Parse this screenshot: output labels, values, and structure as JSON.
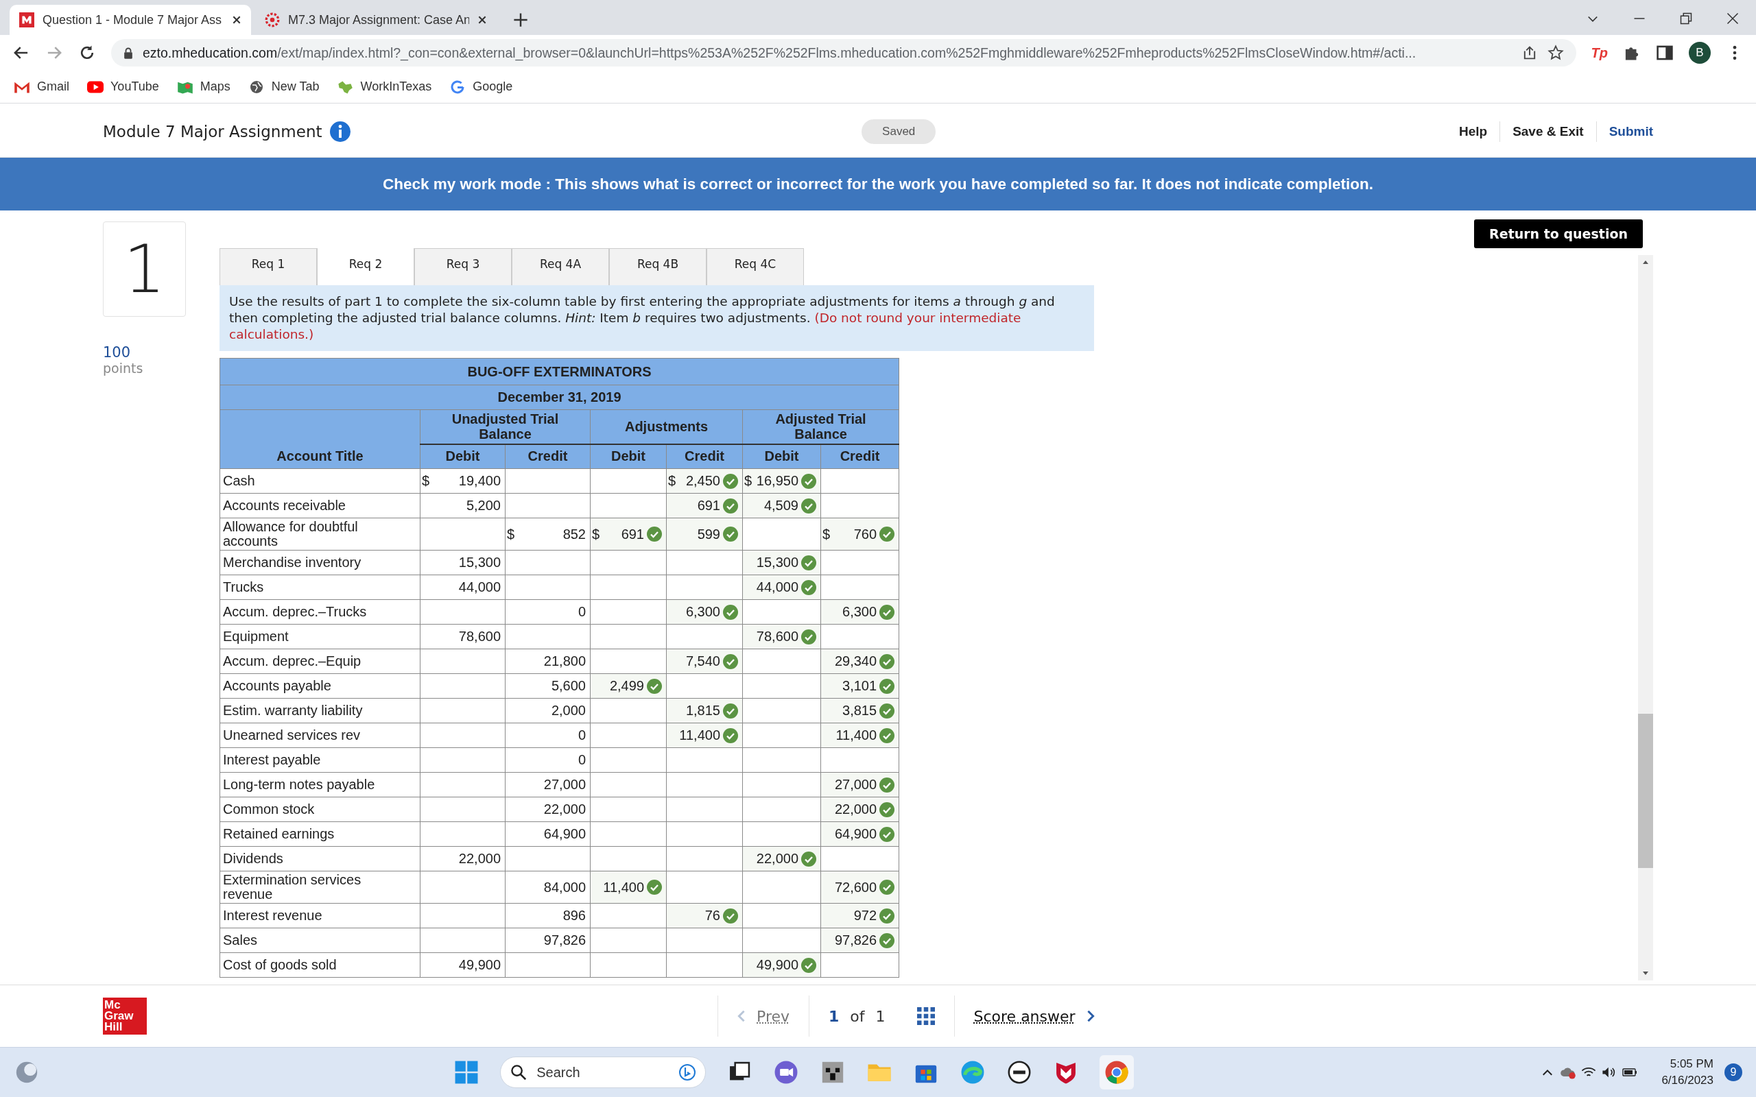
{
  "browser": {
    "tabs": [
      {
        "title": "Question 1 - Module 7 Major Ass",
        "selected": true
      },
      {
        "title": "M7.3 Major Assignment: Case An",
        "selected": false
      }
    ],
    "address": {
      "host": "ezto.mheducation.com",
      "path": "/ext/map/index.html?_con=con&external_browser=0&launchUrl=https%253A%252F%252Flms.mheducation.com%252Fmghmiddleware%252Fmheproducts%252FlmsCloseWindow.htm#/acti..."
    },
    "extension": "Tp",
    "profile": "B",
    "bookmarks": [
      "Gmail",
      "YouTube",
      "Maps",
      "New Tab",
      "WorkInTexas",
      "Google"
    ]
  },
  "header": {
    "title": "Module 7 Major Assignment",
    "status": "Saved",
    "links": [
      "Help",
      "Save & Exit",
      "Submit"
    ]
  },
  "banner": "Check my work mode : This shows what is correct or incorrect for the work you have completed so far. It does not indicate completion.",
  "question": {
    "number": "1",
    "points": "100",
    "points_label": "points"
  },
  "return_button": "Return to question",
  "req_tabs": [
    {
      "label": "Req 1",
      "selected": false
    },
    {
      "label": "Req 2",
      "selected": true
    },
    {
      "label": "Req 3",
      "selected": false
    },
    {
      "label": "Req 4A",
      "selected": false
    },
    {
      "label": "Req 4B",
      "selected": false
    },
    {
      "label": "Req 4C",
      "selected": false
    }
  ],
  "instructions": {
    "text": "Use the results of part 1 to complete the six-column table by first entering the appropriate adjustments for items *a* through *g* and then completing the adjusted trial balance columns. *Hint:* Item *b* requires two adjustments.",
    "note": "(Do not round your intermediate calculations.)"
  },
  "table": {
    "title": "BUG-OFF EXTERMINATORS",
    "date": "December 31, 2019",
    "groups": [
      "Unadjusted Trial Balance",
      "Adjustments",
      "Adjusted Trial Balance"
    ],
    "account_header": "Account Title",
    "columns": [
      "Debit",
      "Credit",
      "Debit",
      "Credit",
      "Debit",
      "Credit"
    ],
    "rows": [
      {
        "account": "Cash",
        "cells": [
          {
            "kind": "given",
            "prefix": "$",
            "value": "19,400"
          },
          null,
          null,
          {
            "kind": "answer",
            "prefix": "$",
            "value": "2,450",
            "correct": true
          },
          {
            "kind": "answer",
            "prefix": "$",
            "value": "16,950",
            "correct": true
          },
          null
        ]
      },
      {
        "account": "Accounts receivable",
        "cells": [
          {
            "kind": "given",
            "value": "5,200"
          },
          null,
          null,
          {
            "kind": "answer",
            "value": "691",
            "correct": true
          },
          {
            "kind": "answer",
            "value": "4,509",
            "correct": true
          },
          null
        ]
      },
      {
        "account": "Allowance for doubtful accounts",
        "cells": [
          null,
          {
            "kind": "given",
            "prefix": "$",
            "value": "852"
          },
          {
            "kind": "answer",
            "prefix": "$",
            "value": "691",
            "correct": true
          },
          {
            "kind": "answer",
            "value": "599",
            "correct": true
          },
          null,
          {
            "kind": "answer",
            "prefix": "$",
            "value": "760",
            "correct": true
          }
        ]
      },
      {
        "account": "Merchandise inventory",
        "cells": [
          {
            "kind": "given",
            "value": "15,300"
          },
          null,
          null,
          null,
          {
            "kind": "answer",
            "value": "15,300",
            "correct": true
          },
          null
        ]
      },
      {
        "account": "Trucks",
        "cells": [
          {
            "kind": "given",
            "value": "44,000"
          },
          null,
          null,
          null,
          {
            "kind": "answer",
            "value": "44,000",
            "correct": true
          },
          null
        ]
      },
      {
        "account": "Accum. deprec.–Trucks",
        "cells": [
          null,
          {
            "kind": "given",
            "value": "0"
          },
          null,
          {
            "kind": "answer",
            "value": "6,300",
            "correct": true
          },
          null,
          {
            "kind": "answer",
            "value": "6,300",
            "correct": true
          }
        ]
      },
      {
        "account": "Equipment",
        "cells": [
          {
            "kind": "given",
            "value": "78,600"
          },
          null,
          null,
          null,
          {
            "kind": "answer",
            "value": "78,600",
            "correct": true
          },
          null
        ]
      },
      {
        "account": "Accum. deprec.–Equip",
        "cells": [
          null,
          {
            "kind": "given",
            "value": "21,800"
          },
          null,
          {
            "kind": "answer",
            "value": "7,540",
            "correct": true
          },
          null,
          {
            "kind": "answer",
            "value": "29,340",
            "correct": true
          }
        ]
      },
      {
        "account": "Accounts payable",
        "cells": [
          null,
          {
            "kind": "given",
            "value": "5,600"
          },
          {
            "kind": "answer",
            "value": "2,499",
            "correct": true
          },
          null,
          null,
          {
            "kind": "answer",
            "value": "3,101",
            "correct": true
          }
        ]
      },
      {
        "account": "Estim. warranty liability",
        "cells": [
          null,
          {
            "kind": "given",
            "value": "2,000"
          },
          null,
          {
            "kind": "answer",
            "value": "1,815",
            "correct": true
          },
          null,
          {
            "kind": "answer",
            "value": "3,815",
            "correct": true
          }
        ]
      },
      {
        "account": "Unearned services rev",
        "cells": [
          null,
          {
            "kind": "given",
            "value": "0"
          },
          null,
          {
            "kind": "answer",
            "value": "11,400",
            "correct": true
          },
          null,
          {
            "kind": "answer",
            "value": "11,400",
            "correct": true
          }
        ]
      },
      {
        "account": "Interest payable",
        "cells": [
          null,
          {
            "kind": "given",
            "value": "0"
          },
          null,
          null,
          null,
          null
        ]
      },
      {
        "account": "Long-term notes payable",
        "cells": [
          null,
          {
            "kind": "given",
            "value": "27,000"
          },
          null,
          null,
          null,
          {
            "kind": "answer",
            "value": "27,000",
            "correct": true
          }
        ]
      },
      {
        "account": "Common stock",
        "cells": [
          null,
          {
            "kind": "given",
            "value": "22,000"
          },
          null,
          null,
          null,
          {
            "kind": "answer",
            "value": "22,000",
            "correct": true
          }
        ]
      },
      {
        "account": "Retained earnings",
        "cells": [
          null,
          {
            "kind": "given",
            "value": "64,900"
          },
          null,
          null,
          null,
          {
            "kind": "answer",
            "value": "64,900",
            "correct": true
          }
        ]
      },
      {
        "account": "Dividends",
        "cells": [
          {
            "kind": "given",
            "value": "22,000"
          },
          null,
          null,
          null,
          {
            "kind": "answer",
            "value": "22,000",
            "correct": true
          },
          null
        ]
      },
      {
        "account": "Extermination services revenue",
        "cells": [
          null,
          {
            "kind": "given",
            "value": "84,000"
          },
          {
            "kind": "answer",
            "value": "11,400",
            "correct": true
          },
          null,
          null,
          {
            "kind": "answer",
            "value": "72,600",
            "correct": true
          }
        ]
      },
      {
        "account": "Interest revenue",
        "cells": [
          null,
          {
            "kind": "given",
            "value": "896"
          },
          null,
          {
            "kind": "answer",
            "value": "76",
            "correct": true
          },
          null,
          {
            "kind": "answer",
            "value": "972",
            "correct": true
          }
        ]
      },
      {
        "account": "Sales",
        "cells": [
          null,
          {
            "kind": "given",
            "value": "97,826"
          },
          null,
          null,
          null,
          {
            "kind": "answer",
            "value": "97,826",
            "correct": true
          }
        ]
      },
      {
        "account": "Cost of goods sold",
        "cells": [
          {
            "kind": "given",
            "value": "49,900"
          },
          null,
          null,
          null,
          {
            "kind": "answer",
            "value": "49,900",
            "correct": true
          },
          null
        ]
      }
    ]
  },
  "footer": {
    "logo": [
      "Mc",
      "Graw",
      "Hill"
    ],
    "prev": "Prev",
    "page": "1",
    "of": "of",
    "total": "1",
    "score": "Score answer"
  },
  "taskbar": {
    "search": "Search",
    "time": "5:05 PM",
    "date": "6/16/2023",
    "notifications": "9"
  }
}
